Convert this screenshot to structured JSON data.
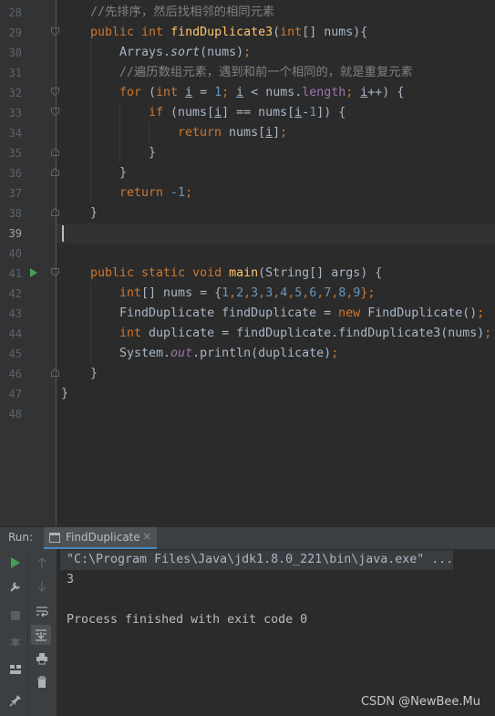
{
  "editor": {
    "line_numbers": [
      "28",
      "29",
      "30",
      "31",
      "32",
      "33",
      "34",
      "35",
      "36",
      "37",
      "38",
      "39",
      "40",
      "41",
      "42",
      "43",
      "44",
      "45",
      "46",
      "47",
      "48"
    ]
  },
  "code": {
    "l28": "//先排序，然后找相邻的相同元素",
    "l29_a": "public int ",
    "l29_b": "findDuplicate3",
    "l29_c": "(",
    "l29_d": "int",
    "l29_e": "[] nums){",
    "l30_a": "Arrays.",
    "l30_b": "sort",
    "l30_c": "(nums)",
    "l30_d": ";",
    "l31": "//遍历数组元素，遇到和前一个相同的，就是重复元素",
    "l32_a": "for ",
    "l32_b": "(",
    "l32_c": "int ",
    "l32_d": "i",
    "l32_e": " = ",
    "l32_f": "1",
    "l32_g": "; ",
    "l32_h": "i",
    "l32_i": " < nums.",
    "l32_j": "length",
    "l32_k": "; ",
    "l32_l": "i",
    "l32_m": "++) {",
    "l33_a": "if ",
    "l33_b": "(nums[",
    "l33_c": "i",
    "l33_d": "] == nums[",
    "l33_e": "i",
    "l33_f": "-",
    "l33_g": "1",
    "l33_h": "]) {",
    "l34_a": "return ",
    "l34_b": "nums[",
    "l34_c": "i",
    "l34_d": "]",
    "l34_e": ";",
    "l35": "}",
    "l36": "}",
    "l37_a": "return ",
    "l37_b": "-1",
    "l37_c": ";",
    "l38": "}",
    "l41_a": "public static void ",
    "l41_b": "main",
    "l41_c": "(String[] args) {",
    "l42_a": "int",
    "l42_b": "[] nums = {",
    "l42_c": "1",
    "l42_d": ",",
    "l42_e": "2",
    "l42_f": ",",
    "l42_g": "3",
    "l42_h": ",",
    "l42_i": "3",
    "l42_j": ",",
    "l42_k": "4",
    "l42_l": ",",
    "l42_m": "5",
    "l42_n": ",",
    "l42_o": "6",
    "l42_p": ",",
    "l42_q": "7",
    "l42_r": ",",
    "l42_s": "8",
    "l42_t": ",",
    "l42_u": "9",
    "l42_v": "};",
    "l43_a": "FindDuplicate findDuplicate = ",
    "l43_b": "new ",
    "l43_c": "FindDuplicate()",
    "l43_d": ";",
    "l44_a": "int ",
    "l44_b": "duplicate = findDuplicate.findDuplicate3(nums)",
    "l44_c": ";",
    "l45_a": "System.",
    "l45_b": "out",
    "l45_c": ".println(duplicate)",
    "l45_d": ";",
    "l46": "}",
    "l47": "}"
  },
  "run_panel": {
    "label": "Run:",
    "tab_label": "FindDuplicate",
    "tab_close": "×",
    "console_lines": [
      "\"C:\\Program Files\\Java\\jdk1.8.0_221\\bin\\java.exe\" ...",
      "3",
      "",
      "Process finished with exit code 0"
    ]
  },
  "watermark": "CSDN @NewBee.Mu",
  "colors": {
    "keyword": "#cc7832",
    "comment": "#808080",
    "function": "#ffc66d",
    "number": "#6897bb",
    "field": "#9876aa",
    "text": "#a9b7c6",
    "run_green": "#499c54"
  }
}
